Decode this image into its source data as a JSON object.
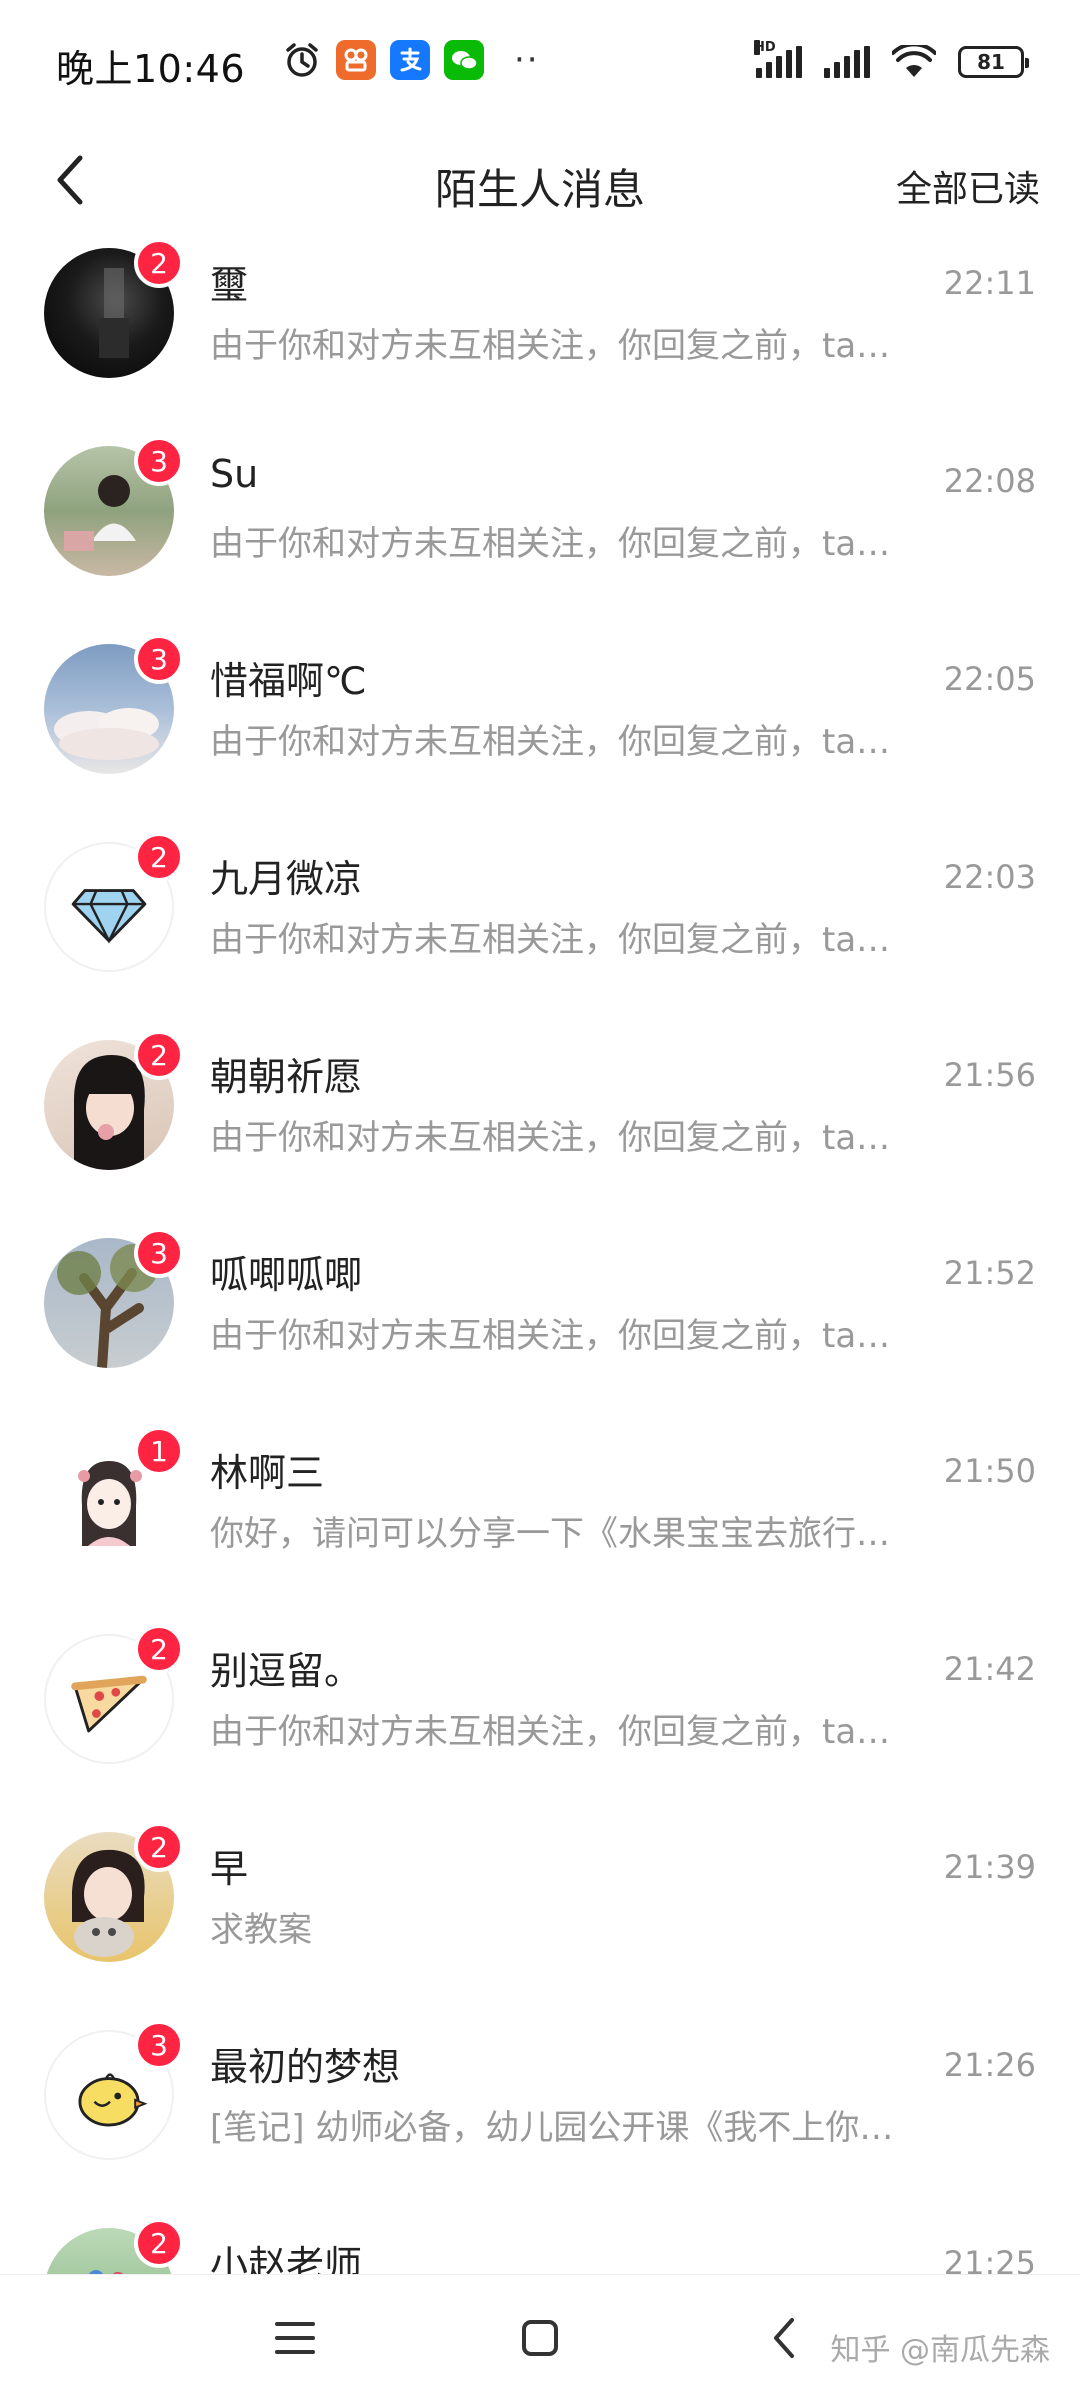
{
  "status_bar": {
    "time": "晚上10:46",
    "hd": "HD",
    "battery": "81",
    "more": "··"
  },
  "header": {
    "title": "陌生人消息",
    "action": "全部已读"
  },
  "messages": [
    {
      "name": "璽",
      "time": "22:11",
      "preview": "由于你和对方未互相关注，你回复之前，ta…",
      "badge": "2",
      "avatar": "dark-photo"
    },
    {
      "name": "Su",
      "time": "22:08",
      "preview": "由于你和对方未互相关注，你回复之前，ta…",
      "badge": "3",
      "avatar": "girl-park-photo"
    },
    {
      "name": "惜福啊℃",
      "time": "22:05",
      "preview": "由于你和对方未互相关注，你回复之前，ta…",
      "badge": "3",
      "avatar": "sky-clouds-photo"
    },
    {
      "name": "九月微凉",
      "time": "22:03",
      "preview": "由于你和对方未互相关注，你回复之前，ta…",
      "badge": "2",
      "avatar": "diamond-icon"
    },
    {
      "name": "朝朝祈愿",
      "time": "21:56",
      "preview": "由于你和对方未互相关注，你回复之前，ta…",
      "badge": "2",
      "avatar": "girl-selfie-photo"
    },
    {
      "name": "呱唧呱唧",
      "time": "21:52",
      "preview": "由于你和对方未互相关注，你回复之前，ta…",
      "badge": "3",
      "avatar": "tree-photo"
    },
    {
      "name": "林啊三",
      "time": "21:50",
      "preview": "你好，请问可以分享一下《水果宝宝去旅行…",
      "badge": "1",
      "avatar": "cartoon-girl"
    },
    {
      "name": "别逗留。",
      "time": "21:42",
      "preview": "由于你和对方未互相关注，你回复之前，ta…",
      "badge": "2",
      "avatar": "pizza-icon"
    },
    {
      "name": "早",
      "time": "21:39",
      "preview": "求教案",
      "badge": "2",
      "avatar": "girl-with-cat-photo"
    },
    {
      "name": "最初的梦想",
      "time": "21:26",
      "preview": "[笔记] 幼师必备，幼儿园公开课《我不上你…",
      "badge": "3",
      "avatar": "chick-icon"
    },
    {
      "name": "小赵老师",
      "time": "21:25",
      "preview": "",
      "badge": "2",
      "avatar": "group-photo"
    }
  ],
  "watermark": "知乎 @南瓜先森",
  "colors": {
    "badge": "#ff2442",
    "secondary_text": "#999999",
    "primary_text": "#222222"
  }
}
